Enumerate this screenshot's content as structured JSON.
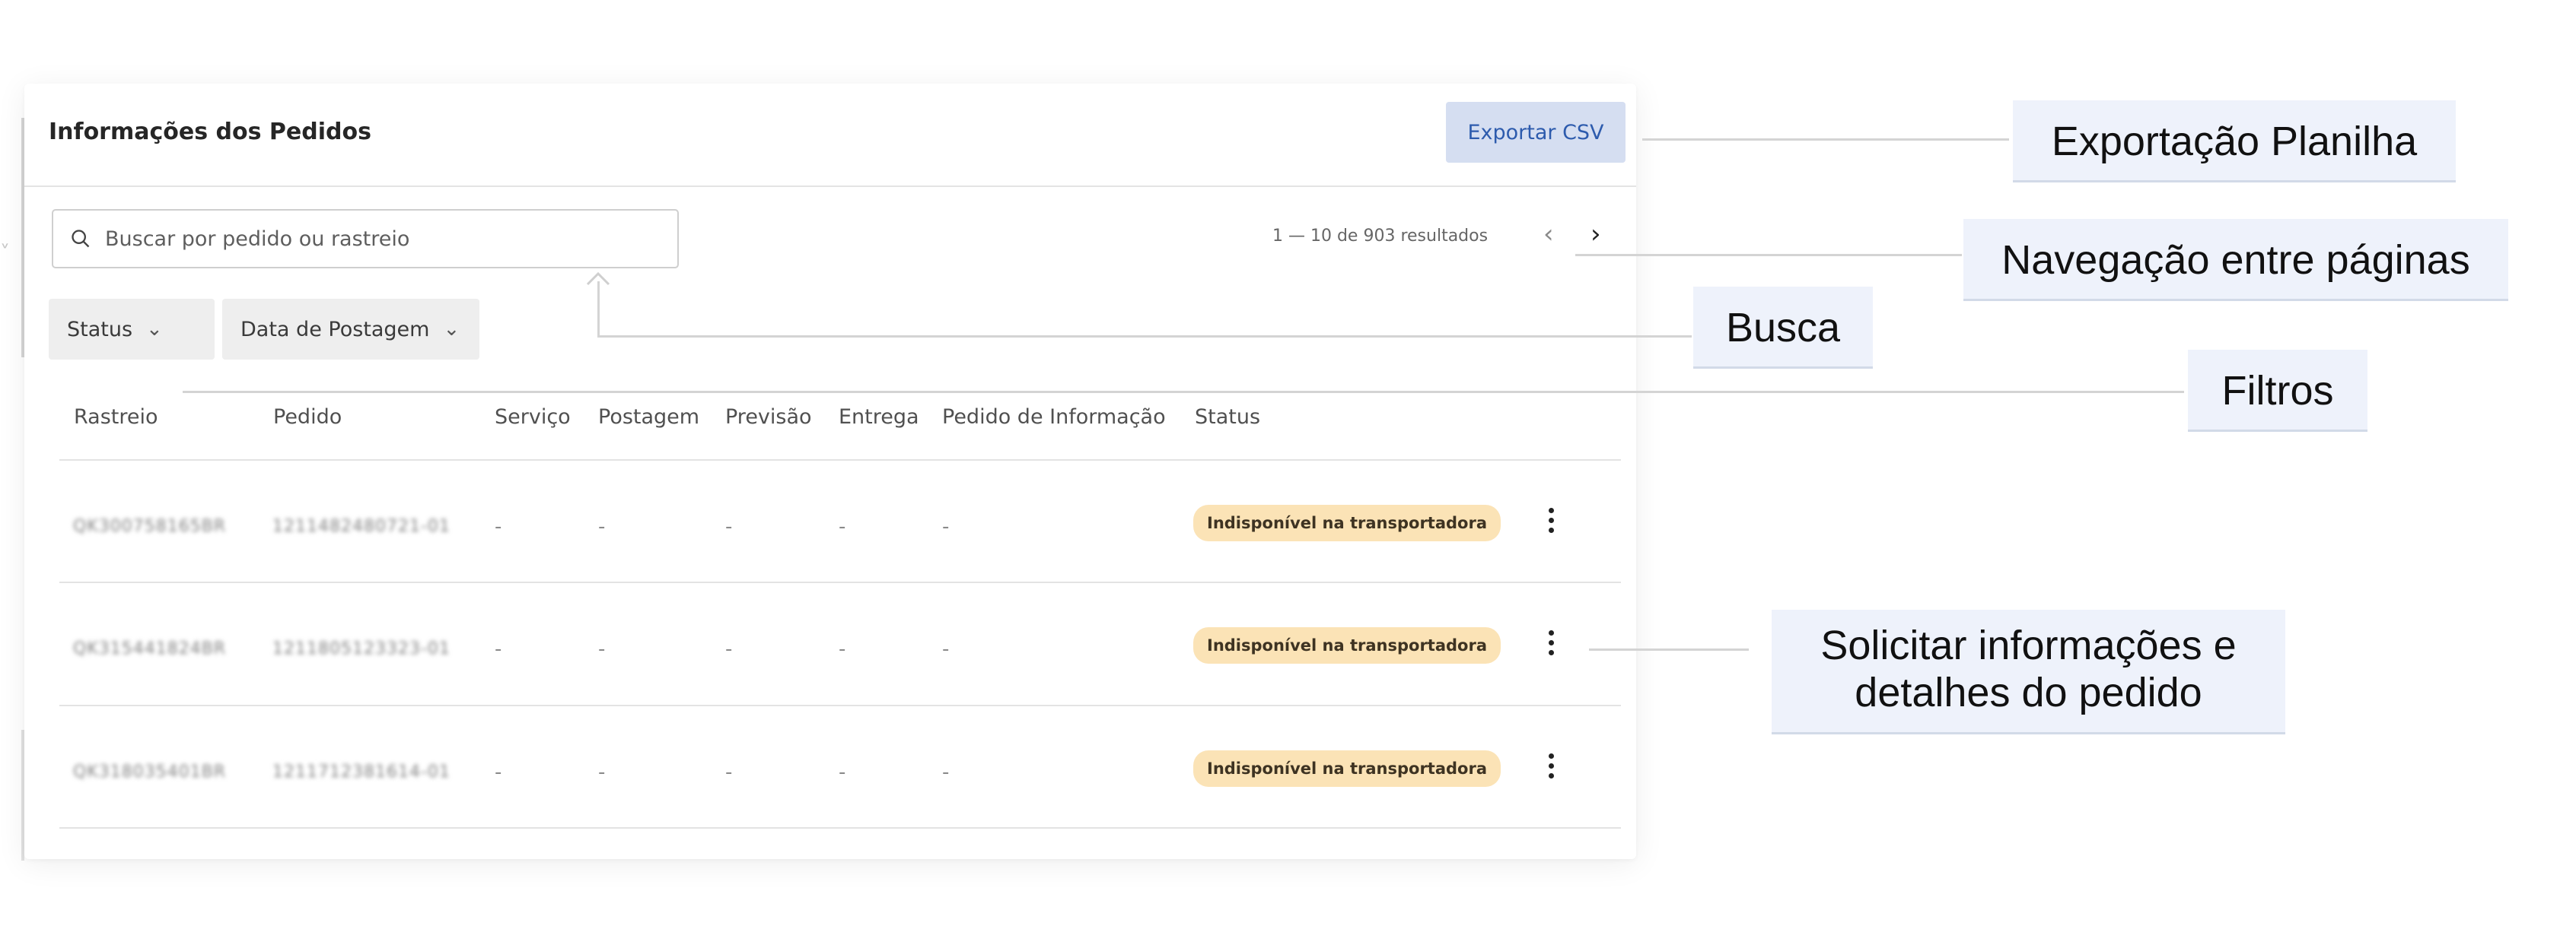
{
  "panel": {
    "title": "Informações dos Pedidos",
    "export_label": "Exportar CSV",
    "search_placeholder": "Buscar por pedido ou rastreio",
    "pagination": {
      "text": "1 — 10 de 903 resultados",
      "prev": "‹",
      "next": "›"
    },
    "filters": [
      {
        "label": "Status"
      },
      {
        "label": "Data de Postagem"
      }
    ],
    "columns": [
      "Rastreio",
      "Pedido",
      "Serviço",
      "Postagem",
      "Previsão",
      "Entrega",
      "Pedido de Informação",
      "Status"
    ],
    "rows": [
      {
        "rastreio": "QK300758165BR",
        "pedido": "1211482480721-01",
        "servico": "-",
        "postagem": "-",
        "previsao": "-",
        "entrega": "-",
        "pedido_info": "-",
        "status": "Indisponível na transportadora"
      },
      {
        "rastreio": "QK315441824BR",
        "pedido": "1211805123323-01",
        "servico": "-",
        "postagem": "-",
        "previsao": "-",
        "entrega": "-",
        "pedido_info": "-",
        "status": "Indisponível na transportadora"
      },
      {
        "rastreio": "QK318035401BR",
        "pedido": "1211712381614-01",
        "servico": "-",
        "postagem": "-",
        "previsao": "-",
        "entrega": "-",
        "pedido_info": "-",
        "status": "Indisponível na transportadora"
      }
    ]
  },
  "annotations": {
    "export": "Exportação Planilha",
    "pagination": "Navegação entre páginas",
    "search": "Busca",
    "filters": "Filtros",
    "details_line1": "Solicitar informações e",
    "details_line2": "detalhes do pedido"
  },
  "colors": {
    "export_button_bg": "#d5def1",
    "export_button_text": "#2d5bad",
    "status_badge_bg": "#fbe3b6",
    "callout_bg": "#eef2fb"
  },
  "icons": [
    "search-icon",
    "chevron-down-icon",
    "chevron-left-icon",
    "chevron-right-icon",
    "kebab-menu-icon"
  ]
}
